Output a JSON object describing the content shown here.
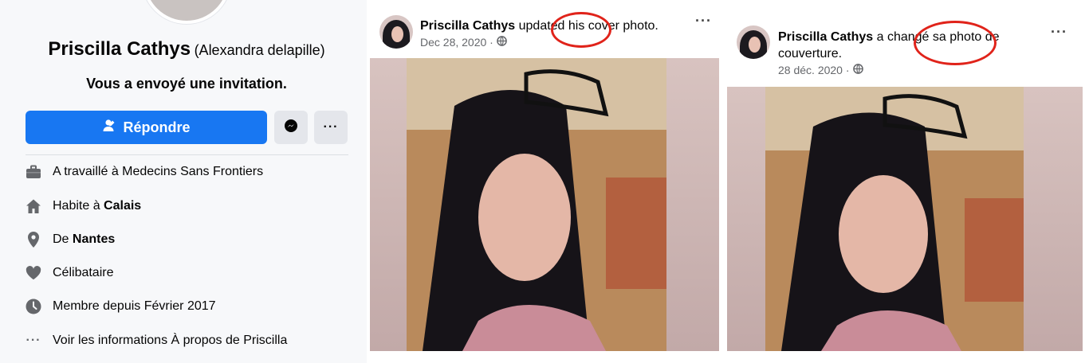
{
  "profile": {
    "name": "Priscilla Cathys",
    "alt_name": "(Alexandra delapille)",
    "invitation": "Vous a envoyé une invitation.",
    "respond_label": "Répondre",
    "info": {
      "work": "A travaillé à Medecins Sans Frontiers",
      "home_prefix": "Habite à ",
      "home_city": "Calais",
      "from_prefix": "De ",
      "from_city": "Nantes",
      "status": "Célibataire",
      "member": "Membre depuis Février 2017",
      "about": "Voir les informations À propos de Priscilla"
    },
    "colors": {
      "accent": "#1877f2",
      "panel_bg": "#f7f8fa",
      "icon": "#65676b"
    }
  },
  "post_en": {
    "author": "Priscilla Cathys",
    "action": " updated his cover photo.",
    "date": "Dec 28, 2020 · ",
    "audience_icon": "globe-icon"
  },
  "post_fr": {
    "author": "Priscilla Cathys",
    "action": " a changé sa photo de couverture.",
    "date": "28 déc. 2020 · ",
    "audience_icon": "globe-icon"
  },
  "annotation_color": "#e0231a"
}
